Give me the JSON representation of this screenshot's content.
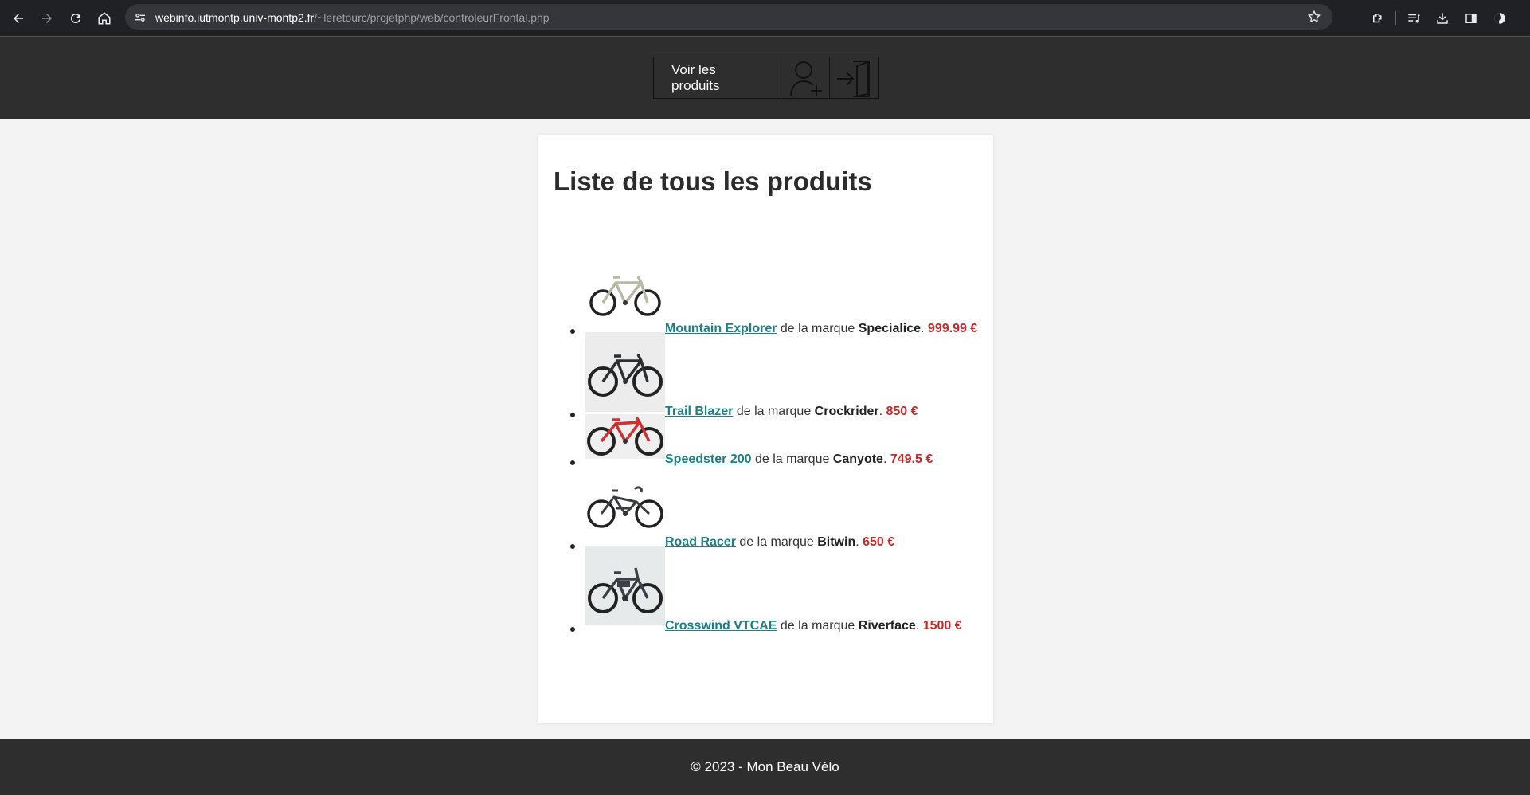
{
  "browser": {
    "url_host": "webinfo.iutmontp.univ-montp2.fr",
    "url_path": "/~leretourc/projetphp/web/controleurFrontal.php"
  },
  "header": {
    "menu": {
      "products_link": "Voir les produits",
      "register_icon": "add-user-icon",
      "login_icon": "login-icon"
    }
  },
  "main": {
    "title": "Liste de tous les produits",
    "brand_prefix": "de la marque",
    "products": [
      {
        "name": "Mountain Explorer",
        "brand": "Specialice",
        "price": "999.99 €",
        "bike_color": "#b9b8a6",
        "thumb_bg": "#ffffff"
      },
      {
        "name": "Trail Blazer",
        "brand": "Crockrider",
        "price": "850 €",
        "bike_color": "#2b2f33",
        "thumb_bg": "#ececec"
      },
      {
        "name": "Speedster 200",
        "brand": "Canyote",
        "price": "749.5 €",
        "bike_color": "#d32f2f",
        "thumb_bg": "#efefef"
      },
      {
        "name": "Road Racer",
        "brand": "Bitwin",
        "price": "650 €",
        "bike_color": "#3a3d40",
        "thumb_bg": "#ffffff"
      },
      {
        "name": "Crosswind VTCAE",
        "brand": "Riverface",
        "price": "1500 €",
        "bike_color": "#3c4046",
        "thumb_bg": "#e6eaeb"
      }
    ]
  },
  "footer": {
    "text": "© 2023 - Mon Beau Vélo"
  }
}
